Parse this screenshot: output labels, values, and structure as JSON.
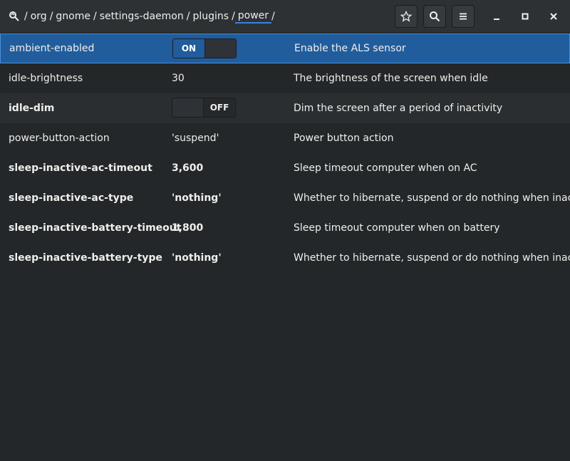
{
  "header": {
    "path": [
      "/",
      "org",
      "/",
      "gnome",
      "/",
      "settings-daemon",
      "/",
      "plugins",
      "/",
      "power",
      "/"
    ],
    "buttons": [
      "star-icon",
      "search-icon",
      "menu-icon"
    ],
    "window_controls": [
      "minimize-icon",
      "maximize-icon",
      "close-icon"
    ]
  },
  "rows": [
    {
      "key": "ambient-enabled",
      "type": "switch",
      "state": "ON",
      "desc": "Enable the ALS sensor",
      "bold": false,
      "selected": true
    },
    {
      "key": "idle-brightness",
      "type": "text",
      "value": "30",
      "desc": "The brightness of the screen when idle",
      "bold": false
    },
    {
      "key": "idle-dim",
      "type": "switch",
      "state": "OFF",
      "desc": "Dim the screen after a period of inactivity",
      "bold": true
    },
    {
      "key": "power-button-action",
      "type": "text",
      "value": "'suspend'",
      "desc": "Power button action",
      "bold": false
    },
    {
      "key": "sleep-inactive-ac-timeout",
      "type": "text",
      "value": "3,600",
      "desc": "Sleep timeout computer when on AC",
      "bold": true
    },
    {
      "key": "sleep-inactive-ac-type",
      "type": "text",
      "value": "'nothing'",
      "desc": "Whether to hibernate, suspend or do nothing when inactive",
      "bold": true
    },
    {
      "key": "sleep-inactive-battery-timeout",
      "type": "text",
      "value": "1,800",
      "desc": "Sleep timeout computer when on battery",
      "bold": true
    },
    {
      "key": "sleep-inactive-battery-type",
      "type": "text",
      "value": "'nothing'",
      "desc": "Whether to hibernate, suspend or do nothing when inactive",
      "bold": true
    }
  ],
  "colors": {
    "accent": "#215d9c",
    "background": "#232729",
    "headerbar": "#2d3134"
  }
}
